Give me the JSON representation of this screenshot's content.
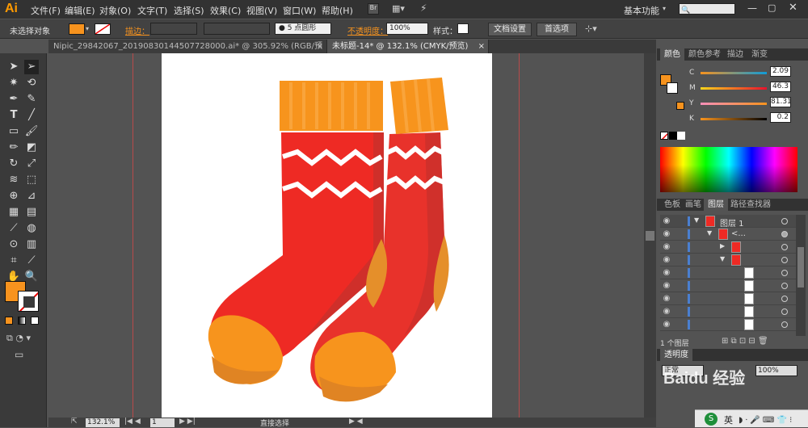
{
  "app": {
    "logo": "Ai"
  },
  "menu": [
    "文件(F)",
    "编辑(E)",
    "对象(O)",
    "文字(T)",
    "选择(S)",
    "效果(C)",
    "视图(V)",
    "窗口(W)",
    "帮助(H)"
  ],
  "menu_right": {
    "workspace": "基本功能",
    "search_placeholder": ""
  },
  "control_bar": {
    "selection": "未选择对象",
    "stroke_label": "描边：",
    "brush": "5 点圆形",
    "opacity_label": "不透明度：",
    "opacity_value": "100%",
    "style_label": "样式：",
    "doc_settings": "文档设置",
    "preferences": "首选项",
    "fill_color": "#f7931e"
  },
  "tabs": [
    {
      "label": "Nipic_29842067_20190830144507728000.ai* @ 305.92% (RGB/预览)",
      "close": "×"
    },
    {
      "label": "未标题-14* @ 132.1% (CMYK/预览)",
      "close": "×"
    }
  ],
  "status": {
    "zoom": "132.1%",
    "page": "1",
    "tool": "直接选择"
  },
  "color_panel": {
    "tabs": [
      "颜色",
      "颜色参考",
      "描边",
      "渐变"
    ],
    "channels": [
      {
        "label": "C",
        "value": "2.09",
        "pct": 0.021
      },
      {
        "label": "M",
        "value": "46.3",
        "pct": 0.463
      },
      {
        "label": "Y",
        "value": "81.31",
        "pct": 0.813
      },
      {
        "label": "K",
        "value": "0.2",
        "pct": 0.002
      }
    ],
    "fill": "#f7931e"
  },
  "layers_panel": {
    "tabs": [
      "色板",
      "画笔",
      "图层",
      "路径查找器"
    ],
    "layer_name": "图层 1",
    "group_name": "<...",
    "footer": "1 个图层"
  },
  "lower_panel": {
    "tab": "透明度",
    "mode": "正常",
    "opacity": "100%"
  },
  "taskbar": {
    "ime": "英"
  },
  "watermark": "Baidu 经验"
}
